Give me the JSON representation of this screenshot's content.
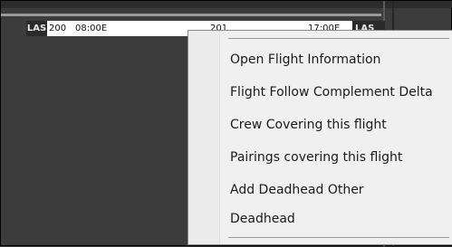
{
  "flight_bar": {
    "departure_station": "LAS",
    "number_left": "200",
    "departure_time": "08:00E",
    "number_right": "201",
    "arrival_time": "17:00E",
    "arrival_station": "LAS"
  },
  "context_menu": {
    "items": [
      {
        "label": "Open Flight Information"
      },
      {
        "label": "Flight Follow Complement Delta"
      },
      {
        "label": "Crew Covering this flight"
      },
      {
        "label": "Pairings covering this flight"
      },
      {
        "label": "Add Deadhead Other"
      },
      {
        "label": "Deadhead"
      }
    ]
  }
}
